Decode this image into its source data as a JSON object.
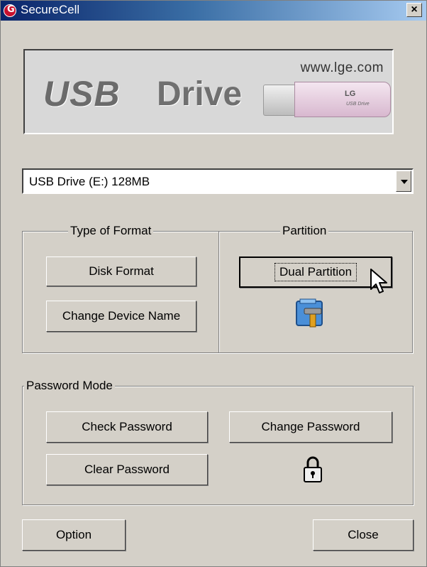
{
  "window": {
    "title": "SecureCell",
    "close_label": "×"
  },
  "banner": {
    "url": "www.lge.com",
    "logo": "USB",
    "drive": "Drive",
    "stick_brand": "LG",
    "stick_sub": "USB Drive"
  },
  "device_select": {
    "value": "USB Drive (E:) 128MB"
  },
  "format_group": {
    "legend": "Type of Format",
    "disk_format": "Disk Format",
    "change_name": "Change Device Name"
  },
  "partition_group": {
    "legend": "Partition",
    "dual_partition": "Dual Partition"
  },
  "password_group": {
    "legend": "Password Mode",
    "check": "Check Password",
    "change": "Change Password",
    "clear": "Clear Password"
  },
  "footer": {
    "option": "Option",
    "close": "Close"
  }
}
